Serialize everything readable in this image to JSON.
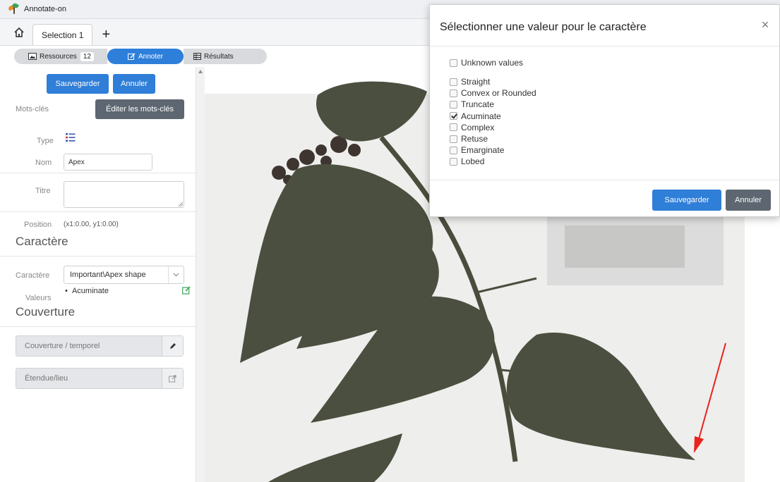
{
  "app": {
    "title": "Annotate-on"
  },
  "tabs": {
    "doc_tab": "Selection 1",
    "add_label": "+"
  },
  "toolbar": {
    "resources_label": "Ressources",
    "resources_count": "12",
    "annotate_label": "Annoter",
    "results_label": "Résultats",
    "annotate_color": "#2e7fd9"
  },
  "panel": {
    "save_label": "Sauvegarder",
    "cancel_label": "Annuler",
    "keywords_label": "Mots-clés",
    "edit_keywords_label": "Éditer les mots-clés",
    "type_label": "Type",
    "name_label": "Nom",
    "name_value": "Apex",
    "title_label": "Titre",
    "title_value": "",
    "position_label": "Position",
    "position_value": "(x1:0.00, y1:0.00)",
    "character_section": "Caractère",
    "character_label": "Caractère",
    "character_value": "Important\\Apex shape",
    "values_label": "Valeurs",
    "values": [
      "Acuminate"
    ],
    "coverage_section": "Couverture",
    "coverage_temporal": "Couverture / temporel",
    "extent_place": "Étendue/lieu"
  },
  "dialog": {
    "title": "Sélectionner une valeur pour le caractère",
    "close_label": "×",
    "unknown_label": "Unknown values",
    "options": [
      {
        "label": "Straight",
        "checked": false
      },
      {
        "label": "Convex or Rounded",
        "checked": false
      },
      {
        "label": "Truncate",
        "checked": false
      },
      {
        "label": "Acuminate",
        "checked": true
      },
      {
        "label": "Complex",
        "checked": false
      },
      {
        "label": "Retuse",
        "checked": false
      },
      {
        "label": "Emarginate",
        "checked": false
      },
      {
        "label": "Lobed",
        "checked": false
      }
    ],
    "save_label": "Sauvegarder",
    "cancel_label": "Annuler"
  },
  "colors": {
    "primary": "#2f7ed8",
    "secondary": "#5d6671",
    "leaf": "#4b4f3f",
    "arrow": "#e8241c"
  },
  "icons": [
    "home-icon",
    "image-icon",
    "edit-icon",
    "table-icon",
    "list-type-icon",
    "edit-square-icon",
    "pencil-icon",
    "external-link-icon",
    "close-icon"
  ]
}
